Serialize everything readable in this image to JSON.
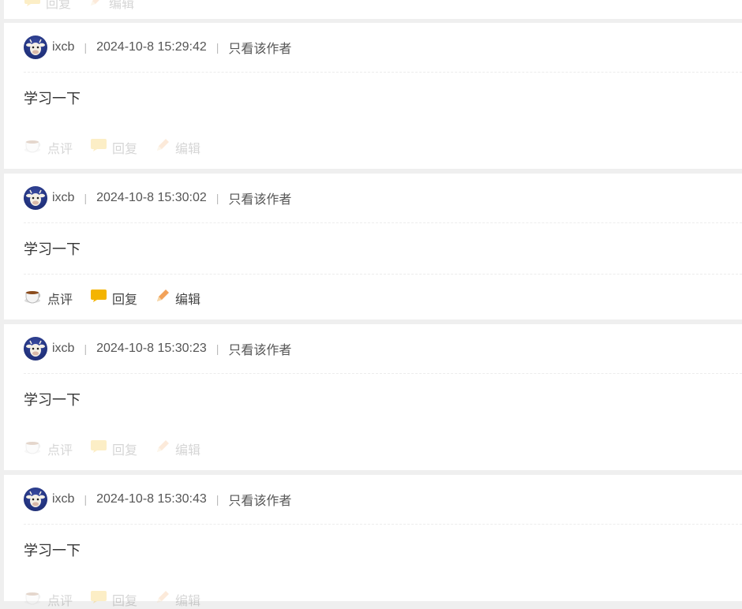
{
  "posts": [
    {
      "author": "ixcb",
      "datetime": "2024-10-8 15:29:42",
      "only_author": "只看该作者",
      "content": "学习一下",
      "actions": {
        "comment": "点评",
        "reply": "回复",
        "edit": "编辑"
      },
      "actions_faded": true
    },
    {
      "author": "ixcb",
      "datetime": "2024-10-8 15:30:02",
      "only_author": "只看该作者",
      "content": "学习一下",
      "actions": {
        "comment": "点评",
        "reply": "回复",
        "edit": "编辑"
      },
      "actions_faded": false
    },
    {
      "author": "ixcb",
      "datetime": "2024-10-8 15:30:23",
      "only_author": "只看该作者",
      "content": "学习一下",
      "actions": {
        "comment": "点评",
        "reply": "回复",
        "edit": "编辑"
      },
      "actions_faded": true
    },
    {
      "author": "ixcb",
      "datetime": "2024-10-8 15:30:43",
      "only_author": "只看该作者",
      "content": "学习一下",
      "actions": {
        "comment": "点评",
        "reply": "回复",
        "edit": "编辑"
      },
      "actions_faded": true
    }
  ],
  "top_partial_actions": {
    "reply": "回复",
    "edit": "编辑"
  },
  "icons": {
    "comment": "coffee-cup-icon",
    "reply": "speech-bubble-icon",
    "edit": "pencil-icon",
    "avatar": "cow-avatar"
  },
  "colors": {
    "page_bg": "#efefef",
    "card_bg": "#ffffff",
    "text": "#333333",
    "meta": "#555555",
    "reply_icon": "#f4b400",
    "edit_icon": "#f2a25a"
  }
}
